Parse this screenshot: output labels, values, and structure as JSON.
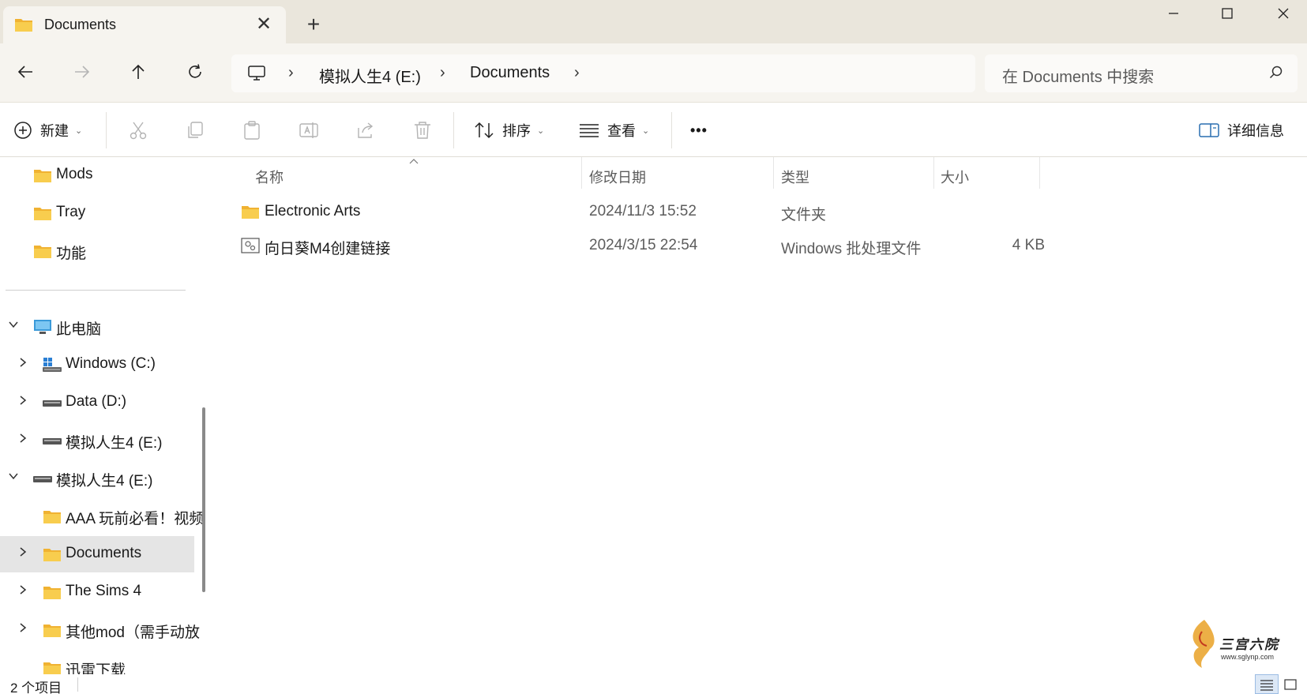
{
  "window": {
    "tab_title": "Documents",
    "new_tab_symbol": "+",
    "close_tab_symbol": "✕",
    "minimize_symbol": "—",
    "maximize_symbol": "☐",
    "close_symbol": "✕"
  },
  "address_bar": {
    "breadcrumbs": [
      "模拟人生4 (E:)",
      "Documents"
    ],
    "separator": "›"
  },
  "search": {
    "placeholder": "在 Documents 中搜索"
  },
  "toolbar": {
    "new_label": "新建",
    "sort_label": "排序",
    "view_label": "查看",
    "more_label": "•••",
    "details_label": "详细信息"
  },
  "sidebar": {
    "items": [
      {
        "label": "Mods",
        "icon": "folder-icon"
      },
      {
        "label": "Tray",
        "icon": "folder-icon"
      },
      {
        "label": "功能",
        "icon": "folder-icon"
      },
      {
        "label": "此电脑",
        "icon": "computer-icon",
        "expanded": true
      },
      {
        "label": "Windows (C:)",
        "icon": "windows-drive-icon",
        "expanded": false
      },
      {
        "label": "Data (D:)",
        "icon": "drive-icon",
        "expanded": false
      },
      {
        "label": "模拟人生4 (E:)",
        "icon": "drive-icon",
        "expanded": false
      },
      {
        "label": "模拟人生4 (E:)",
        "icon": "drive-icon",
        "expanded": true
      },
      {
        "label": "AAA 玩前必看！视频",
        "icon": "folder-icon"
      },
      {
        "label": "Documents",
        "icon": "folder-icon",
        "selected": true
      },
      {
        "label": "The Sims 4",
        "icon": "folder-icon"
      },
      {
        "label": "其他mod（需手动放",
        "icon": "folder-icon"
      },
      {
        "label": "迅雷下载",
        "icon": "folder-icon"
      }
    ]
  },
  "columns": {
    "name": "名称",
    "modified": "修改日期",
    "type": "类型",
    "size": "大小"
  },
  "files": [
    {
      "name": "Electronic Arts",
      "modified": "2024/11/3 15:52",
      "type": "文件夹",
      "size": "",
      "icon": "folder-icon"
    },
    {
      "name": "向日葵M4创建链接",
      "modified": "2024/3/15 22:54",
      "type": "Windows 批处理文件",
      "size": "4 KB",
      "icon": "batch-file-icon"
    }
  ],
  "status": {
    "item_count": "2 个项目"
  },
  "watermark": {
    "text": "三宫六院",
    "url": "www.sglynp.com"
  },
  "colors": {
    "titlebar": "#eae6dc",
    "navbar": "#f6f4ef",
    "folder_yellow": "#f5c542",
    "selected_row": "#e5e5e5"
  }
}
